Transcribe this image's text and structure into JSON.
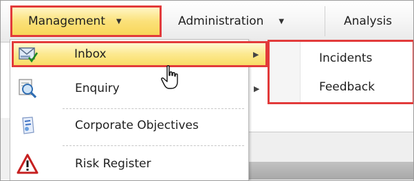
{
  "menubar": {
    "items": [
      {
        "label": "Management",
        "caret": "▼"
      },
      {
        "label": "Administration",
        "caret": "▼"
      },
      {
        "label": "Analysis"
      }
    ]
  },
  "dropdown": {
    "items": [
      {
        "label": "Inbox",
        "icon": "inbox-icon",
        "arrow": "▶"
      },
      {
        "label": "Enquiry",
        "icon": "enquiry-icon",
        "arrow": "▶"
      },
      {
        "label": "Corporate Objectives",
        "icon": "corporate-objectives-icon"
      },
      {
        "label": "Risk Register",
        "icon": "warning-icon"
      }
    ]
  },
  "submenu": {
    "items": [
      {
        "label": "Incidents"
      },
      {
        "label": "Feedback"
      }
    ]
  },
  "colors": {
    "highlight_border": "#e23a3a",
    "highlight_fill": "#fce98f"
  }
}
